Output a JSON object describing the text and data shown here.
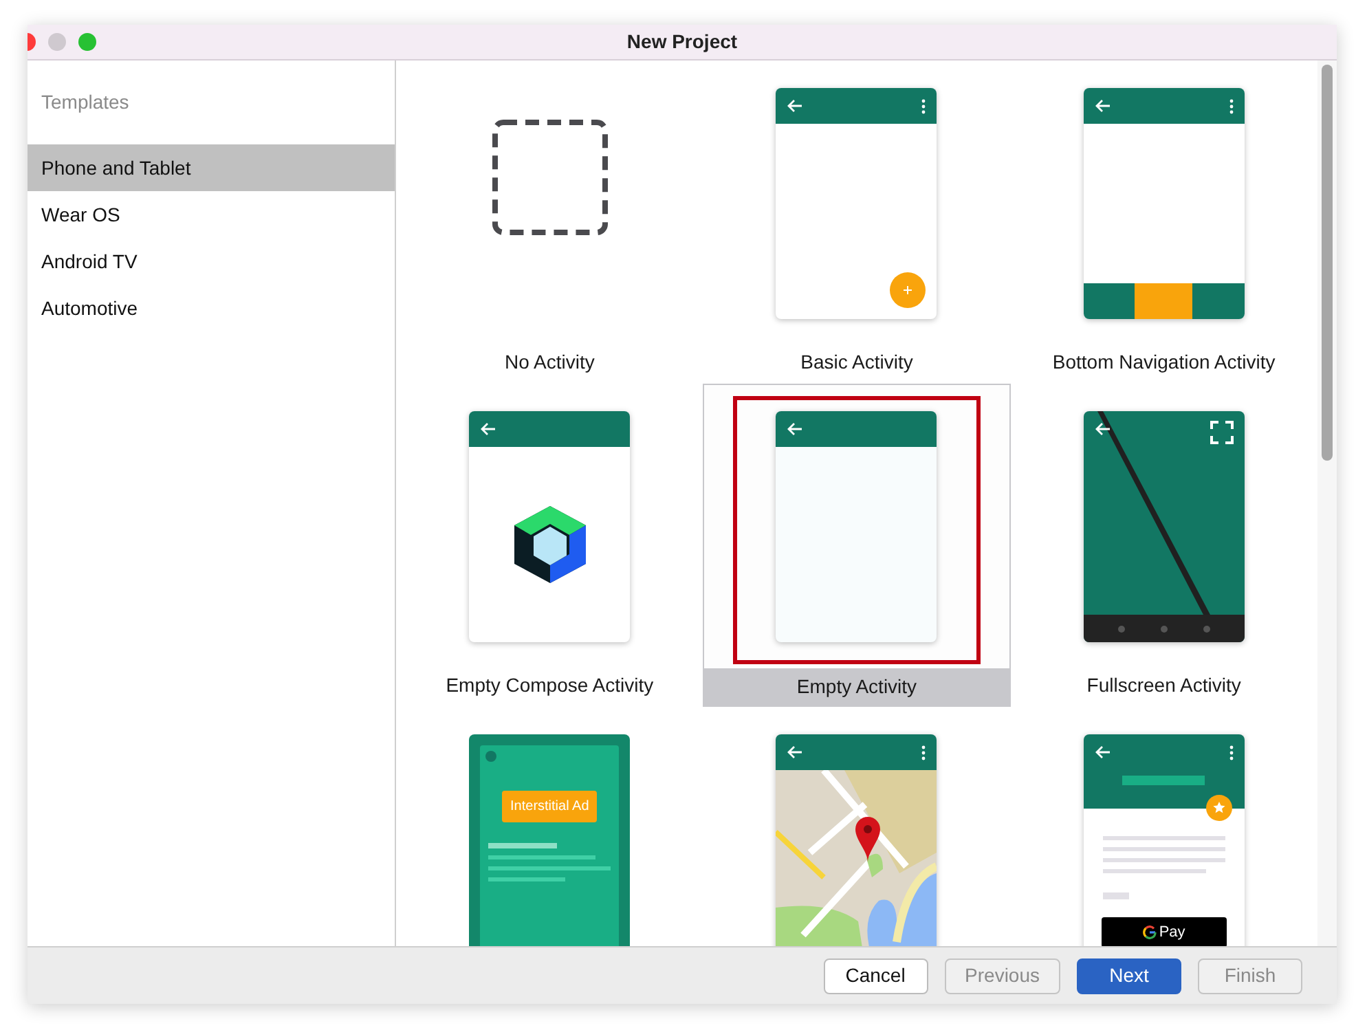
{
  "window": {
    "title": "New Project"
  },
  "sidebar": {
    "heading": "Templates",
    "items": [
      {
        "label": "Phone and Tablet",
        "selected": true
      },
      {
        "label": "Wear OS",
        "selected": false
      },
      {
        "label": "Android TV",
        "selected": false
      },
      {
        "label": "Automotive",
        "selected": false
      }
    ]
  },
  "templates": [
    {
      "label": "No Activity",
      "kind": "none",
      "selected": false
    },
    {
      "label": "Basic Activity",
      "kind": "basic",
      "selected": false
    },
    {
      "label": "Bottom Navigation Activity",
      "kind": "bottom_nav",
      "selected": false
    },
    {
      "label": "Empty Compose Activity",
      "kind": "compose",
      "selected": false
    },
    {
      "label": "Empty Activity",
      "kind": "empty",
      "selected": true,
      "highlighted": true
    },
    {
      "label": "Fullscreen Activity",
      "kind": "fullscreen",
      "selected": false
    },
    {
      "kind": "interstitial_ad",
      "selected": false,
      "preview_text": "Interstitial Ad"
    },
    {
      "kind": "maps",
      "selected": false
    },
    {
      "kind": "google_pay",
      "selected": false,
      "preview_text": "Pay"
    }
  ],
  "buttons": [
    {
      "label": "Cancel",
      "kind": "default",
      "disabled": false
    },
    {
      "label": "Previous",
      "kind": "default",
      "disabled": true
    },
    {
      "label": "Next",
      "kind": "primary",
      "disabled": false
    },
    {
      "label": "Finish",
      "kind": "default",
      "disabled": true
    }
  ]
}
